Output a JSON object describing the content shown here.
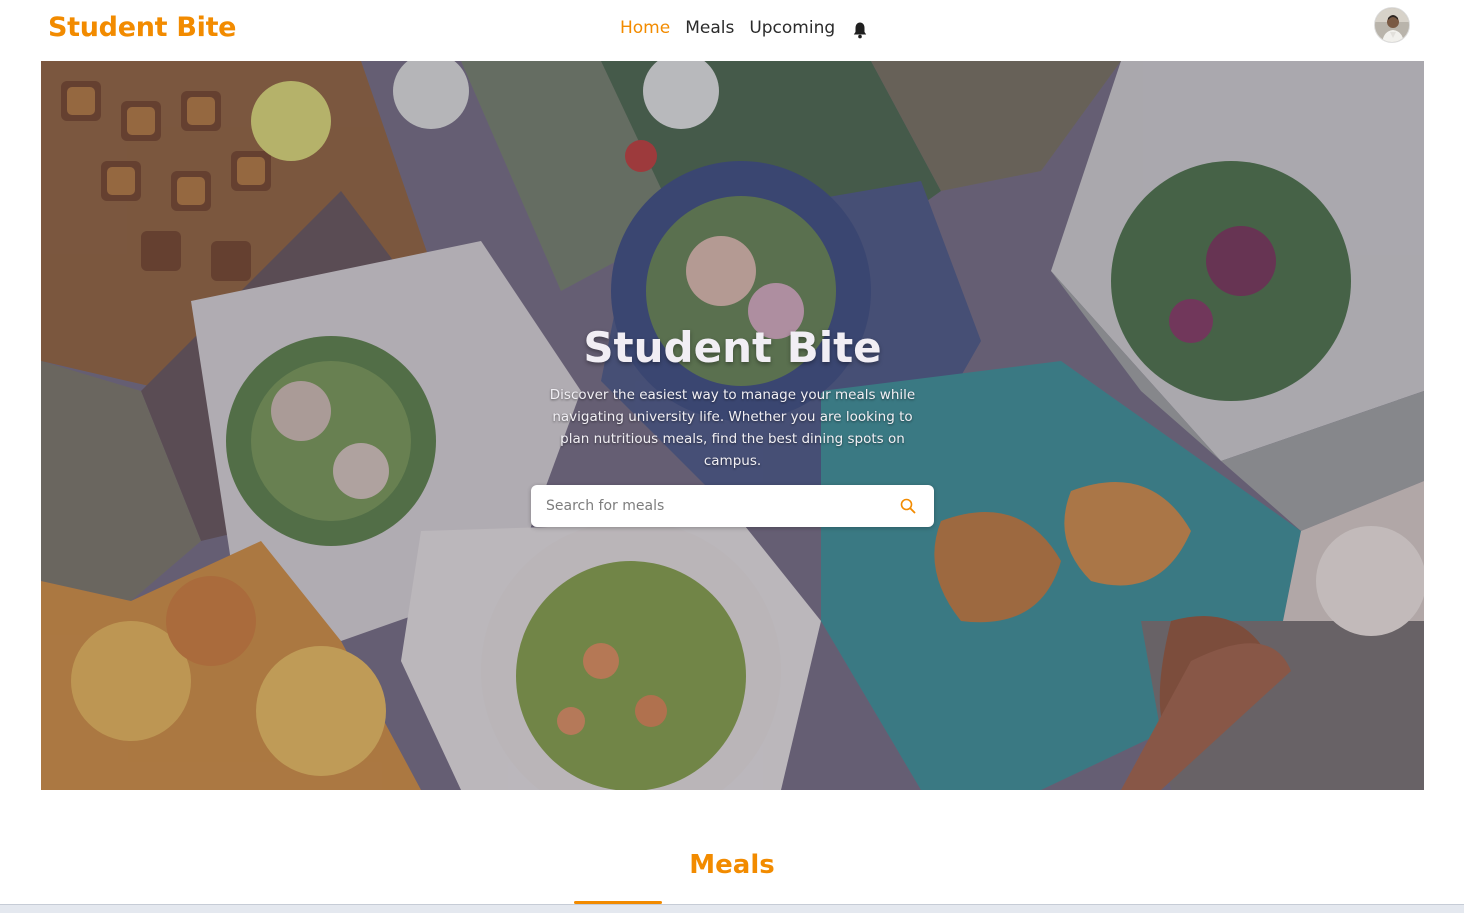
{
  "brand": {
    "name": "Student Bite",
    "color": "#f28b00"
  },
  "nav": {
    "items": [
      {
        "label": "Home",
        "active": true
      },
      {
        "label": "Meals",
        "active": false
      },
      {
        "label": "Upcoming",
        "active": false
      }
    ],
    "notification_icon": "bell-icon",
    "avatar_icon": "user-avatar"
  },
  "hero": {
    "title": "Student Bite",
    "description": "Discover the easiest way to manage your meals while navigating university life. Whether you are looking to plan nutritious meals, find the best dining spots on campus.",
    "search": {
      "placeholder": "Search for meals",
      "value": "",
      "icon": "search-icon"
    }
  },
  "sections": {
    "meals_title": "Meals"
  }
}
